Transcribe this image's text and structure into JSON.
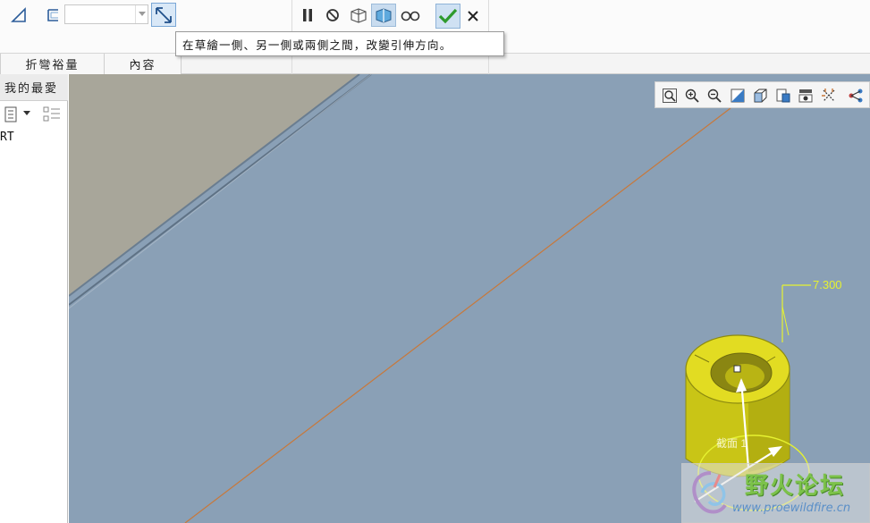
{
  "ribbon": {
    "depth_value": "",
    "tooltip_text": "在草繪一側、另一側或兩側之間，改變引伸方向。"
  },
  "tabs": [
    {
      "label": "折彎裕量"
    },
    {
      "label": "內容"
    }
  ],
  "left_panel": {
    "header": "我的最愛",
    "tree_item": "RT"
  },
  "viewport": {
    "dimension_value": "7.300",
    "section_label": "截面 1"
  },
  "watermark": {
    "title": "野火论坛",
    "url": "www.proewildfire.cn"
  },
  "colors": {
    "viewport_bg": "#8aa0b6",
    "part_yellow": "#d8d21a",
    "dimension": "#e6f230",
    "ok_check": "#2e9a2e"
  }
}
